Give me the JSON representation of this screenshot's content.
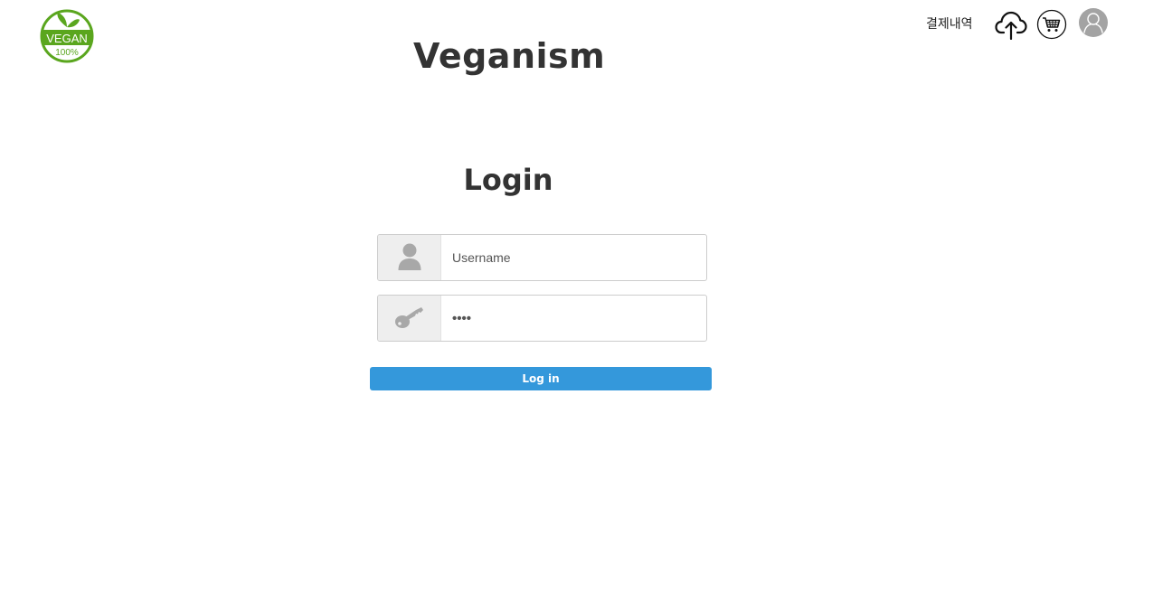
{
  "logo": {
    "badge_text": "VEGAN",
    "badge_subtext": "100%",
    "icon": "vegan-badge-icon",
    "color": "#5aa61e"
  },
  "site_title": "Veganism",
  "header": {
    "history_label": "결제내역",
    "upload_icon": "cloud-upload-icon",
    "cart_icon": "shopping-cart-icon",
    "profile_icon": "user-avatar-icon"
  },
  "login": {
    "title": "Login",
    "username": {
      "placeholder": "Username",
      "value": "",
      "icon": "user-icon"
    },
    "password": {
      "placeholder": "",
      "value": "••••",
      "icon": "key-icon"
    },
    "submit_label": "Log in"
  },
  "colors": {
    "primary_button": "#3498db",
    "addon_bg": "#eeeeee",
    "icon_gray": "#a8a8a8",
    "title_text": "#333333"
  }
}
